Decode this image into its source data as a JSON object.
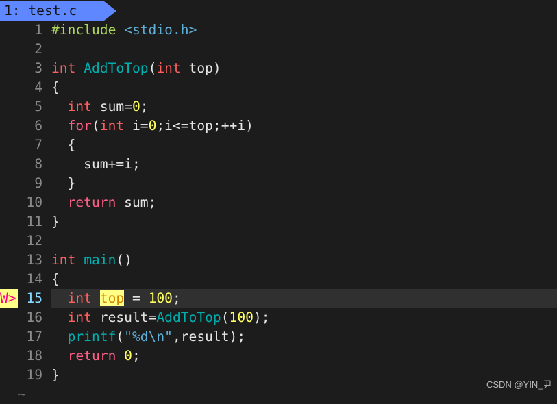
{
  "tab": {
    "label": "1: test.c",
    "color": "#5f87ff"
  },
  "sign": {
    "line": 15,
    "text": "W>"
  },
  "cursor_line": 15,
  "lines": [
    {
      "n": "1",
      "tokens": [
        [
          "#include",
          "pp"
        ],
        [
          " ",
          "plain"
        ],
        [
          "<stdio.h>",
          "inc"
        ]
      ]
    },
    {
      "n": "2",
      "tokens": []
    },
    {
      "n": "3",
      "tokens": [
        [
          "int",
          "kw"
        ],
        [
          " ",
          "plain"
        ],
        [
          "AddToTop",
          "fn"
        ],
        [
          "(",
          "plain"
        ],
        [
          "int",
          "kw"
        ],
        [
          " top)",
          "plain"
        ]
      ]
    },
    {
      "n": "4",
      "tokens": [
        [
          "{",
          "plain"
        ]
      ]
    },
    {
      "n": "5",
      "tokens": [
        [
          "  ",
          "plain"
        ],
        [
          "int",
          "kw"
        ],
        [
          " sum=",
          "plain"
        ],
        [
          "0",
          "num-lit"
        ],
        [
          ";",
          "plain"
        ]
      ]
    },
    {
      "n": "6",
      "tokens": [
        [
          "  ",
          "plain"
        ],
        [
          "for",
          "kw2"
        ],
        [
          "(",
          "plain"
        ],
        [
          "int",
          "kw"
        ],
        [
          " i=",
          "plain"
        ],
        [
          "0",
          "num-lit"
        ],
        [
          ";i<=top;++i)",
          "plain"
        ]
      ]
    },
    {
      "n": "7",
      "tokens": [
        [
          "  {",
          "plain"
        ]
      ]
    },
    {
      "n": "8",
      "tokens": [
        [
          "    sum+=i;",
          "plain"
        ]
      ]
    },
    {
      "n": "9",
      "tokens": [
        [
          "  }",
          "plain"
        ]
      ]
    },
    {
      "n": "10",
      "tokens": [
        [
          "  ",
          "plain"
        ],
        [
          "return",
          "kw2"
        ],
        [
          " sum;",
          "plain"
        ]
      ]
    },
    {
      "n": "11",
      "tokens": [
        [
          "}",
          "plain"
        ]
      ]
    },
    {
      "n": "12",
      "tokens": []
    },
    {
      "n": "13",
      "tokens": [
        [
          "int",
          "kw"
        ],
        [
          " ",
          "plain"
        ],
        [
          "main",
          "fn"
        ],
        [
          "()",
          "plain"
        ]
      ]
    },
    {
      "n": "14",
      "tokens": [
        [
          "{",
          "plain"
        ]
      ]
    },
    {
      "n": "15",
      "tokens": [
        [
          "  ",
          "plain"
        ],
        [
          "int",
          "kw"
        ],
        [
          " ",
          "plain"
        ],
        [
          "top",
          "hl"
        ],
        [
          " = ",
          "plain"
        ],
        [
          "100",
          "num-lit"
        ],
        [
          ";",
          "plain"
        ]
      ]
    },
    {
      "n": "16",
      "tokens": [
        [
          "  ",
          "plain"
        ],
        [
          "int",
          "kw"
        ],
        [
          " result=",
          "plain"
        ],
        [
          "AddToTop",
          "fn"
        ],
        [
          "(",
          "plain"
        ],
        [
          "100",
          "num-lit"
        ],
        [
          ");",
          "plain"
        ]
      ]
    },
    {
      "n": "17",
      "tokens": [
        [
          "  ",
          "plain"
        ],
        [
          "printf",
          "fn"
        ],
        [
          "(",
          "plain"
        ],
        [
          "\"%d\\n\"",
          "str"
        ],
        [
          ",result);",
          "plain"
        ]
      ]
    },
    {
      "n": "18",
      "tokens": [
        [
          "  ",
          "plain"
        ],
        [
          "return",
          "kw2"
        ],
        [
          " ",
          "plain"
        ],
        [
          "0",
          "num-lit"
        ],
        [
          ";",
          "plain"
        ]
      ]
    },
    {
      "n": "19",
      "tokens": [
        [
          "}",
          "plain"
        ]
      ]
    }
  ],
  "tilde": "~",
  "watermark": "CSDN @YIN_尹"
}
